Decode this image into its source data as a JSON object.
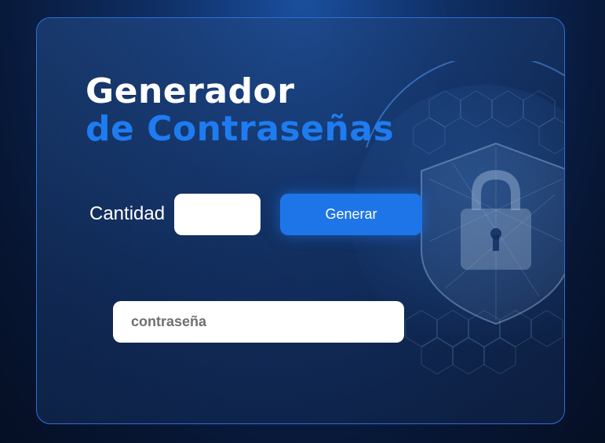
{
  "header": {
    "title_line1": "Generador",
    "title_line2": "de Contraseñas"
  },
  "form": {
    "quantity_label": "Cantidad",
    "quantity_value": "",
    "generate_label": "Generar",
    "password_value": "",
    "password_placeholder": "contraseña"
  },
  "icons": {
    "background": "shield-padlock-globe-icon"
  },
  "colors": {
    "accent": "#1d75e8",
    "title_accent": "#1e7cf0",
    "card_border": "#2c6fd6",
    "background": "#0f2e63"
  }
}
